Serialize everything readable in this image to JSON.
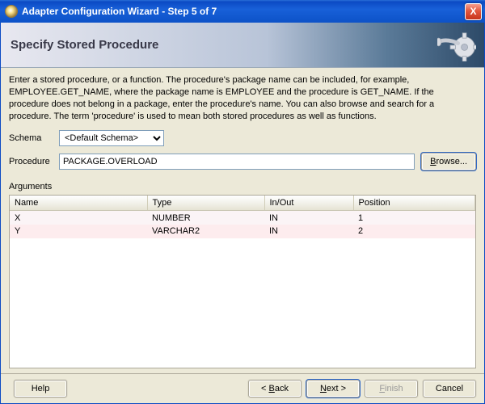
{
  "window": {
    "title": "Adapter Configuration Wizard - Step 5 of 7",
    "close_glyph": "X"
  },
  "header": {
    "title": "Specify Stored Procedure"
  },
  "description": "Enter a stored procedure, or a function. The procedure's package name can be included, for example, EMPLOYEE.GET_NAME, where the package name is EMPLOYEE and the procedure is GET_NAME.  If the procedure does not belong in a package, enter the procedure's name. You can also browse and search for a procedure. The term 'procedure' is used to mean both stored procedures as well as functions.",
  "schema": {
    "label": "Schema",
    "selected": "<Default Schema>"
  },
  "procedure": {
    "label": "Procedure",
    "value": "PACKAGE.OVERLOAD",
    "browse_label": "Browse..."
  },
  "arguments": {
    "label": "Arguments",
    "columns": {
      "name": "Name",
      "type": "Type",
      "inout": "In/Out",
      "position": "Position"
    },
    "rows": [
      {
        "name": "X",
        "type": "NUMBER",
        "inout": "IN",
        "position": "1"
      },
      {
        "name": "Y",
        "type": "VARCHAR2",
        "inout": "IN",
        "position": "2"
      }
    ]
  },
  "buttons": {
    "help": "Help",
    "back": "< Back",
    "next": "Next >",
    "finish": "Finish",
    "cancel": "Cancel"
  }
}
